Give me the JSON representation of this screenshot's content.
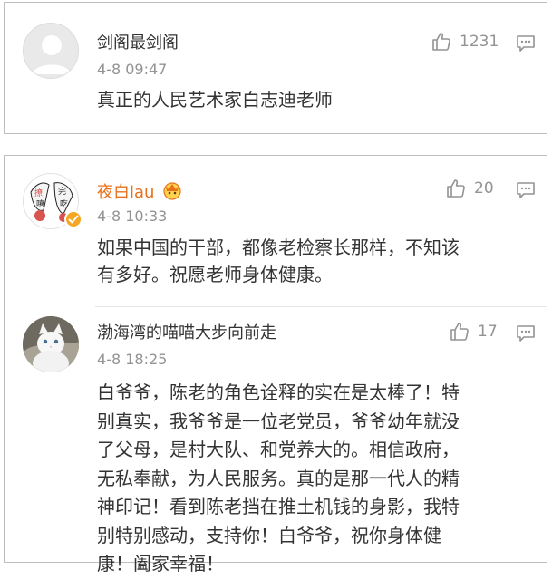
{
  "colors": {
    "orange_name": "#e8711c",
    "text": "#333333",
    "meta": "#939393",
    "verified": "#f5a623"
  },
  "comments": [
    {
      "user": "剑阁最剑阁",
      "time": "4-8 09:47",
      "likes": "1231",
      "text": "真正的人民艺术家白志迪老师",
      "avatar_icon": "default-avatar-icon"
    },
    {
      "user": "夜白lau",
      "time": "4-8 10:33",
      "likes": "20",
      "text": "如果中国的干部，都像老检察长那样，不知该有多好。祝愿老师身体健康。",
      "avatar_icon": "cartoon-avatar-icon",
      "avatar_text": [
        "撩",
        "完",
        "嘻",
        "吃"
      ],
      "verified": true,
      "badge_icon": "vip-crown-icon"
    },
    {
      "user": "渤海湾的喵喵大步向前走",
      "time": "4-8 18:25",
      "likes": "17",
      "text": "白爷爷，陈老的角色诠释的实在是太棒了！特别真实，我爷爷是一位老党员，爷爷幼年就没了父母，是村大队、和党养大的。相信政府，无私奉献，为人民服务。真的是那一代人的精神印记！看到陈老挡在推土机钱的身影，我特别特别感动，支持你！白爷爷，祝你身体健康！阖家幸福！",
      "avatar_icon": "white-cat-avatar-icon"
    }
  ]
}
